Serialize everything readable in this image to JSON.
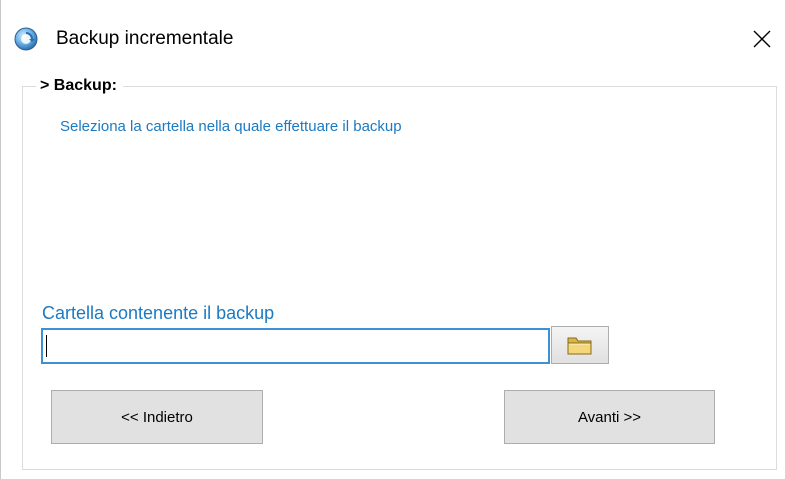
{
  "window": {
    "title": "Backup incrementale",
    "close_icon": "close-icon"
  },
  "group": {
    "legend": "> Backup:",
    "instruction": "Seleziona la cartella nella quale effettuare il backup"
  },
  "folder_field": {
    "label": "Cartella contenente il backup",
    "value": "",
    "browse_icon": "folder-icon"
  },
  "buttons": {
    "back_label": "<< Indietro",
    "next_label": "Avanti >>"
  },
  "colors": {
    "accent_text": "#1b7ac2",
    "input_focus_border": "#3f8fd4",
    "button_face": "#e1e1e1"
  }
}
